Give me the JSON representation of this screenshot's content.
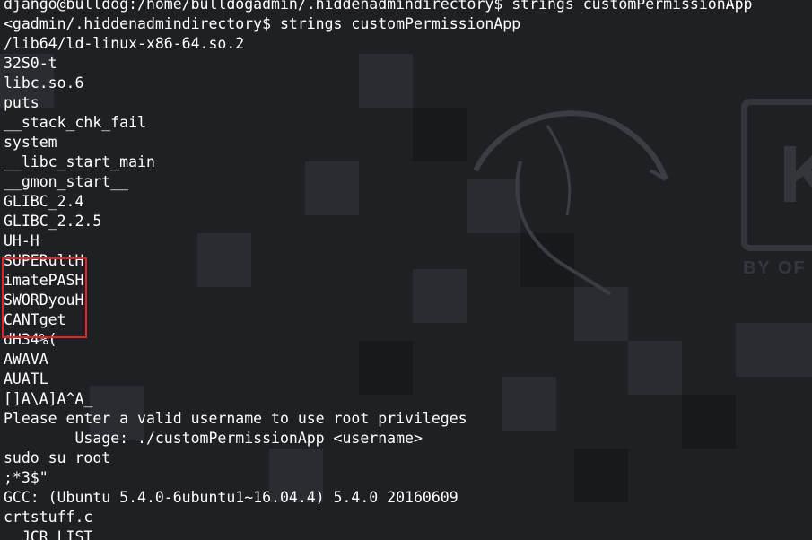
{
  "terminal": {
    "lines": [
      "django@bulldog:/home/bulldogadmin/.hiddenadmindirectory$ strings customPermissionApp",
      "<gadmin/.hiddenadmindirectory$ strings customPermissionApp",
      "/lib64/ld-linux-x86-64.so.2",
      "32S0-t",
      "libc.so.6",
      "puts",
      "__stack_chk_fail",
      "system",
      "__libc_start_main",
      "__gmon_start__",
      "GLIBC_2.4",
      "GLIBC_2.2.5",
      "UH-H",
      "SUPERultH",
      "imatePASH",
      "SWORDyouH",
      "CANTget",
      "dH34%(",
      "AWAVA",
      "AUATL",
      "[]A\\A]A^A_",
      "Please enter a valid username to use root privileges",
      "        Usage: ./customPermissionApp <username>",
      "sudo su root",
      ";*3$\"",
      "GCC: (Ubuntu 5.4.0-6ubuntu1~16.04.4) 5.4.0 20160609",
      "crtstuff.c",
      "__JCR_LIST__"
    ],
    "text_color": "#ffffff",
    "background_color": "#1f2024"
  },
  "annotation": {
    "highlight_color": "#e0262a"
  },
  "wallpaper": {
    "logo_letter": "K",
    "logo_caption": "BY OF"
  }
}
